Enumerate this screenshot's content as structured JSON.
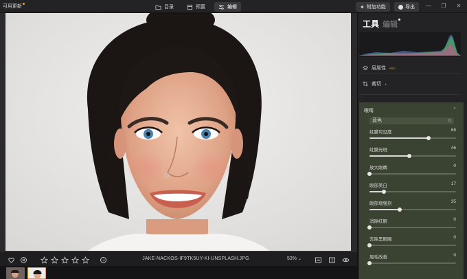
{
  "topbar": {
    "update_label": "可用更新",
    "nav": [
      {
        "label": "目录",
        "icon": "folder-icon"
      },
      {
        "label": "预置",
        "icon": "preset-icon"
      },
      {
        "label": "编辑",
        "icon": "sliders-icon"
      }
    ],
    "addon_label": "附加功能",
    "export_label": "导出",
    "window_controls": [
      "—",
      "❐",
      "✕"
    ]
  },
  "image": {
    "filename": "JAKE-NACKOS-IF9TK5UY-KI-UNSPLASH.JPG",
    "zoom": "53%"
  },
  "rating": {
    "stars": 0,
    "max": 5
  },
  "panel": {
    "title": "工具",
    "tab2": "编辑",
    "layers_label": "层属性",
    "layers_badge": "PRO",
    "crop_label": "裁切",
    "section_title": "眼睛",
    "color_select": "蓝色",
    "sliders": [
      {
        "label": "虹膜可见度",
        "value": 68,
        "min": 0,
        "max": 100
      },
      {
        "label": "虹膜光斑",
        "value": 46,
        "min": 0,
        "max": 100
      },
      {
        "label": "放大眼睛",
        "value": 0,
        "min": 0,
        "max": 100
      },
      {
        "label": "眼部美白",
        "value": 17,
        "min": 0,
        "max": 100
      },
      {
        "label": "眼部增强剂",
        "value": 35,
        "min": 0,
        "max": 100
      },
      {
        "label": "消除红眼",
        "value": 0,
        "min": 0,
        "max": 100
      },
      {
        "label": "去除黑眼圈",
        "value": 0,
        "min": 0,
        "max": 100
      },
      {
        "label": "眉毛改善",
        "value": 0,
        "min": 0,
        "max": 100
      }
    ]
  },
  "colors": {
    "accent": "#e8a33a",
    "panel_bg": "#232325",
    "section_bg": "#3a4231"
  }
}
